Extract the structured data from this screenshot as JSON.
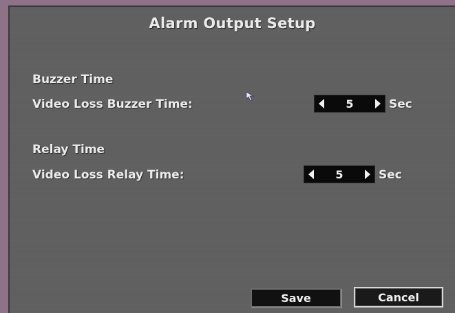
{
  "dialog": {
    "title": "Alarm Output Setup"
  },
  "buzzer": {
    "section_label": "Buzzer Time",
    "field_label": "Video Loss Buzzer Time:",
    "value": "5",
    "unit": "Sec"
  },
  "relay": {
    "section_label": "Relay Time",
    "field_label": "Video Loss Relay Time:",
    "value": "5",
    "unit": "Sec"
  },
  "buttons": {
    "save_label": "Save",
    "cancel_label": "Cancel"
  },
  "colors": {
    "outer_frame": "#8e7287",
    "panel_bg": "#5f5f5f",
    "text": "#ececec",
    "control_bg": "#0a0a0a"
  }
}
